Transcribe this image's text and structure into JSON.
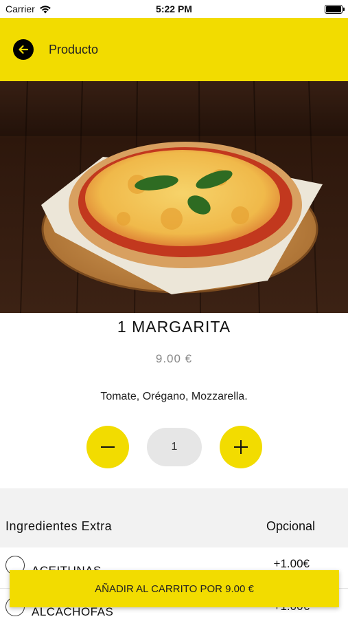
{
  "status_bar": {
    "carrier": "Carrier",
    "time": "5:22 PM"
  },
  "header": {
    "title": "Producto",
    "back_icon": "arrow-left-icon"
  },
  "product": {
    "name": "1 MARGARITA",
    "price": "9.00 €",
    "description": "Tomate, Orégano, Mozzarella.",
    "image": "pizza-margarita-photo"
  },
  "quantity": {
    "value": "1",
    "minus_icon": "minus-icon",
    "plus_icon": "plus-icon"
  },
  "extras": {
    "title": "Ingredientes Extra",
    "optional_label": "Opcional",
    "items": [
      {
        "name": "ACEITUNAS",
        "price": "+1.00€"
      },
      {
        "name": "ALCACHOFAS",
        "price": "+1.00€"
      }
    ]
  },
  "cart": {
    "button_label": "AÑADIR AL CARRITO POR 9.00 €"
  },
  "colors": {
    "accent": "#f2dc00",
    "background": "#ffffff",
    "section_bg": "#f2f2f2"
  }
}
